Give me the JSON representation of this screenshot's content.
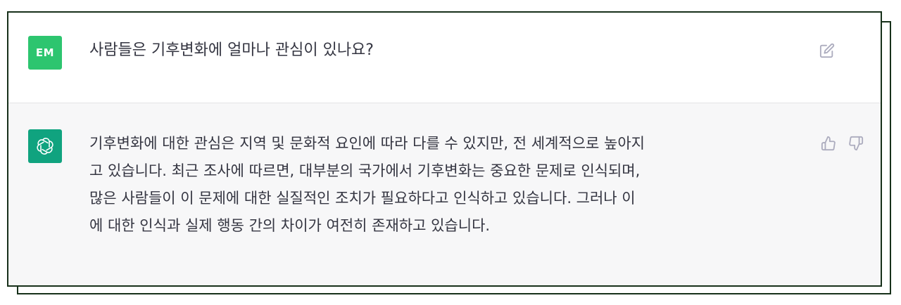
{
  "colors": {
    "frame_border": "#17301a",
    "user_avatar_bg": "#2dc56f",
    "bot_avatar_bg": "#10a37f",
    "bot_bg": "#f7f7f8",
    "text": "#343541",
    "icon": "#acacbe"
  },
  "user_message": {
    "avatar_initials": "EM",
    "text": "사람들은 기후변화에 얼마나 관심이 있나요?",
    "edit_icon": "edit-icon"
  },
  "bot_message": {
    "avatar_icon": "openai-logo-icon",
    "lines": [
      "기후변화에 대한 관심은 지역 및 문화적 요인에 따라 다를 수 있지만, 전 세계적으로 높아지",
      "고 있습니다. 최근 조사에 따르면, 대부분의 국가에서 기후변화는 중요한 문제로 인식되며,",
      "많은 사람들이 이 문제에 대한 실질적인 조치가 필요하다고 인식하고 있습니다. 그러나 이",
      "에 대한 인식과 실제 행동 간의 차이가 여전히 존재하고 있습니다."
    ],
    "thumbs_up_icon": "thumbs-up-icon",
    "thumbs_down_icon": "thumbs-down-icon"
  }
}
